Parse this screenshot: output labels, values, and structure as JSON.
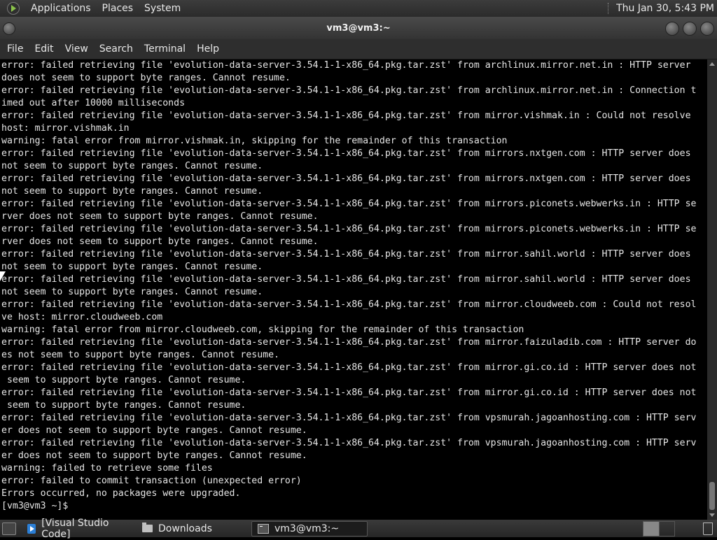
{
  "top_panel": {
    "menus": [
      "Applications",
      "Places",
      "System"
    ],
    "clock": "Thu Jan 30,  5:43 PM"
  },
  "window": {
    "title": "vm3@vm3:~"
  },
  "menubar": {
    "items": [
      "File",
      "Edit",
      "View",
      "Search",
      "Terminal",
      "Help"
    ]
  },
  "terminal": {
    "lines": [
      "error: failed retrieving file 'evolution-data-server-3.54.1-1-x86_64.pkg.tar.zst' from archlinux.mirror.net.in : HTTP server",
      "does not seem to support byte ranges. Cannot resume.",
      "error: failed retrieving file 'evolution-data-server-3.54.1-1-x86_64.pkg.tar.zst' from archlinux.mirror.net.in : Connection t",
      "imed out after 10000 milliseconds",
      "error: failed retrieving file 'evolution-data-server-3.54.1-1-x86_64.pkg.tar.zst' from mirror.vishmak.in : Could not resolve",
      "host: mirror.vishmak.in",
      "warning: fatal error from mirror.vishmak.in, skipping for the remainder of this transaction",
      "error: failed retrieving file 'evolution-data-server-3.54.1-1-x86_64.pkg.tar.zst' from mirrors.nxtgen.com : HTTP server does",
      "not seem to support byte ranges. Cannot resume.",
      "error: failed retrieving file 'evolution-data-server-3.54.1-1-x86_64.pkg.tar.zst' from mirrors.nxtgen.com : HTTP server does",
      "not seem to support byte ranges. Cannot resume.",
      "error: failed retrieving file 'evolution-data-server-3.54.1-1-x86_64.pkg.tar.zst' from mirrors.piconets.webwerks.in : HTTP se",
      "rver does not seem to support byte ranges. Cannot resume.",
      "error: failed retrieving file 'evolution-data-server-3.54.1-1-x86_64.pkg.tar.zst' from mirrors.piconets.webwerks.in : HTTP se",
      "rver does not seem to support byte ranges. Cannot resume.",
      "error: failed retrieving file 'evolution-data-server-3.54.1-1-x86_64.pkg.tar.zst' from mirror.sahil.world : HTTP server does",
      "not seem to support byte ranges. Cannot resume.",
      "error: failed retrieving file 'evolution-data-server-3.54.1-1-x86_64.pkg.tar.zst' from mirror.sahil.world : HTTP server does",
      "not seem to support byte ranges. Cannot resume.",
      "error: failed retrieving file 'evolution-data-server-3.54.1-1-x86_64.pkg.tar.zst' from mirror.cloudweeb.com : Could not resol",
      "ve host: mirror.cloudweeb.com",
      "warning: fatal error from mirror.cloudweeb.com, skipping for the remainder of this transaction",
      "error: failed retrieving file 'evolution-data-server-3.54.1-1-x86_64.pkg.tar.zst' from mirror.faizuladib.com : HTTP server do",
      "es not seem to support byte ranges. Cannot resume.",
      "error: failed retrieving file 'evolution-data-server-3.54.1-1-x86_64.pkg.tar.zst' from mirror.gi.co.id : HTTP server does not",
      " seem to support byte ranges. Cannot resume.",
      "error: failed retrieving file 'evolution-data-server-3.54.1-1-x86_64.pkg.tar.zst' from mirror.gi.co.id : HTTP server does not",
      " seem to support byte ranges. Cannot resume.",
      "error: failed retrieving file 'evolution-data-server-3.54.1-1-x86_64.pkg.tar.zst' from vpsmurah.jagoanhosting.com : HTTP serv",
      "er does not seem to support byte ranges. Cannot resume.",
      "error: failed retrieving file 'evolution-data-server-3.54.1-1-x86_64.pkg.tar.zst' from vpsmurah.jagoanhosting.com : HTTP serv",
      "er does not seem to support byte ranges. Cannot resume.",
      "warning: failed to retrieve some files",
      "error: failed to commit transaction (unexpected error)",
      "Errors occurred, no packages were upgraded.",
      "[vm3@vm3 ~]$ "
    ]
  },
  "taskbar": {
    "tasks": [
      {
        "label": "[Visual Studio Code]",
        "icon": "vscode-icon"
      },
      {
        "label": "Downloads",
        "icon": "folder-icon"
      },
      {
        "label": "vm3@vm3:~",
        "icon": "terminal-icon"
      }
    ]
  }
}
